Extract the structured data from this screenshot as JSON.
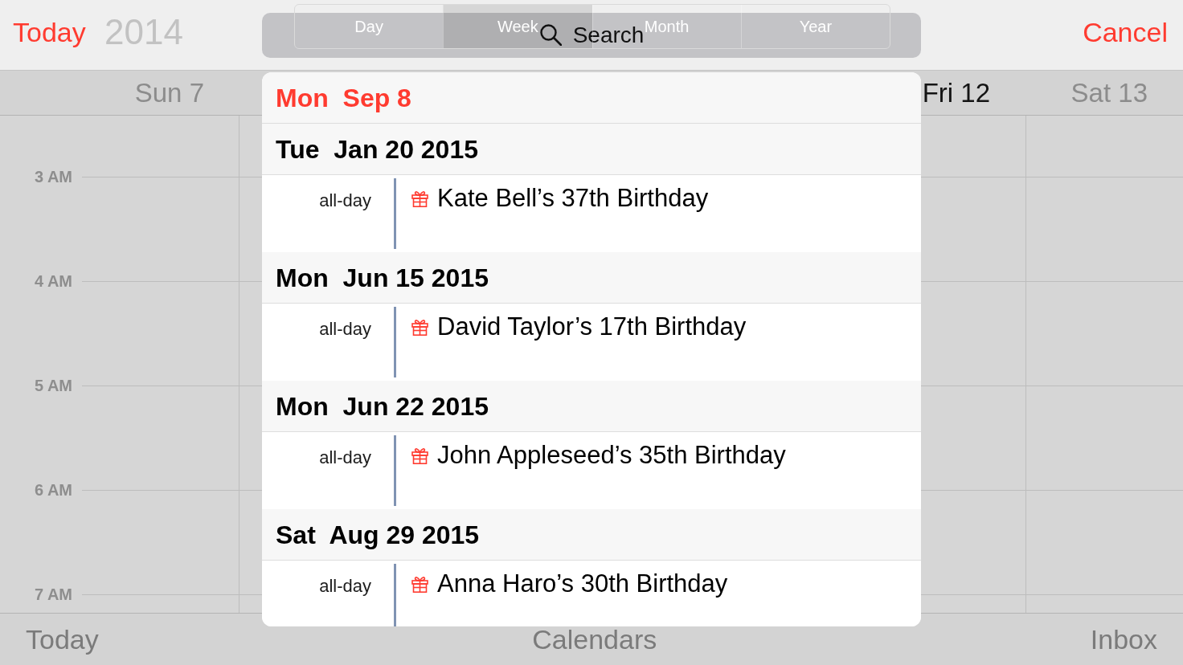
{
  "top_bar": {
    "today": "Today",
    "title": "2014",
    "view_segments": [
      {
        "label": "Day",
        "selected": false
      },
      {
        "label": "Week",
        "selected": true
      },
      {
        "label": "Month",
        "selected": false
      },
      {
        "label": "Year",
        "selected": false
      }
    ],
    "search": {
      "placeholder": "Search"
    },
    "cancel": "Cancel"
  },
  "day_headers": [
    {
      "label": "Sun 7",
      "weekend": true
    },
    {
      "label": "Fri 12",
      "weekend": false
    },
    {
      "label": "Sat 13",
      "weekend": true
    }
  ],
  "time_labels": [
    "3 AM",
    "4 AM",
    "5 AM",
    "6 AM",
    "7 AM"
  ],
  "search_results": {
    "current_date": "Mon  Sep 8",
    "groups": [
      {
        "date": "Tue  Jan 20 2015",
        "events": [
          {
            "time": "all-day",
            "title": "Kate Bell’s 37th Birthday"
          }
        ]
      },
      {
        "date": "Mon  Jun 15 2015",
        "events": [
          {
            "time": "all-day",
            "title": "David Taylor’s 17th Birthday"
          }
        ]
      },
      {
        "date": "Mon  Jun 22 2015",
        "events": [
          {
            "time": "all-day",
            "title": "John Appleseed’s 35th Birthday"
          }
        ]
      },
      {
        "date": "Sat  Aug 29 2015",
        "events": [
          {
            "time": "all-day",
            "title": "Anna Haro’s 30th Birthday"
          }
        ]
      }
    ]
  },
  "toolbar": [
    "Today",
    "Calendars",
    "Inbox"
  ]
}
